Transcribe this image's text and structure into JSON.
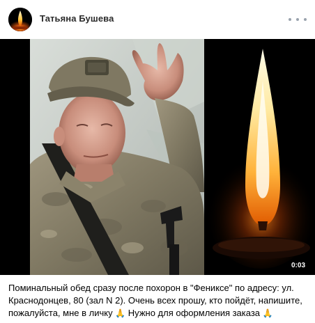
{
  "post": {
    "author": {
      "name": "Татьяна Бушева",
      "avatar": "candle-avatar"
    },
    "menu_icon": "more-dots-icon",
    "video": {
      "duration": "0:03",
      "content": [
        "soldier-photo",
        "candle-flame"
      ]
    },
    "caption": {
      "line1": "Поминальный обед сразу после похорон в \"Фениксе\" по адресу: ул.",
      "line2": "Краснодонцев, 80 (зал N 2). Очень всех прошу, кто пойдёт, напишите,",
      "line3_a": "пожалуйста, мне в личку",
      "line3_b": "Нужно для оформления заказа",
      "emoji": "🙏"
    }
  }
}
